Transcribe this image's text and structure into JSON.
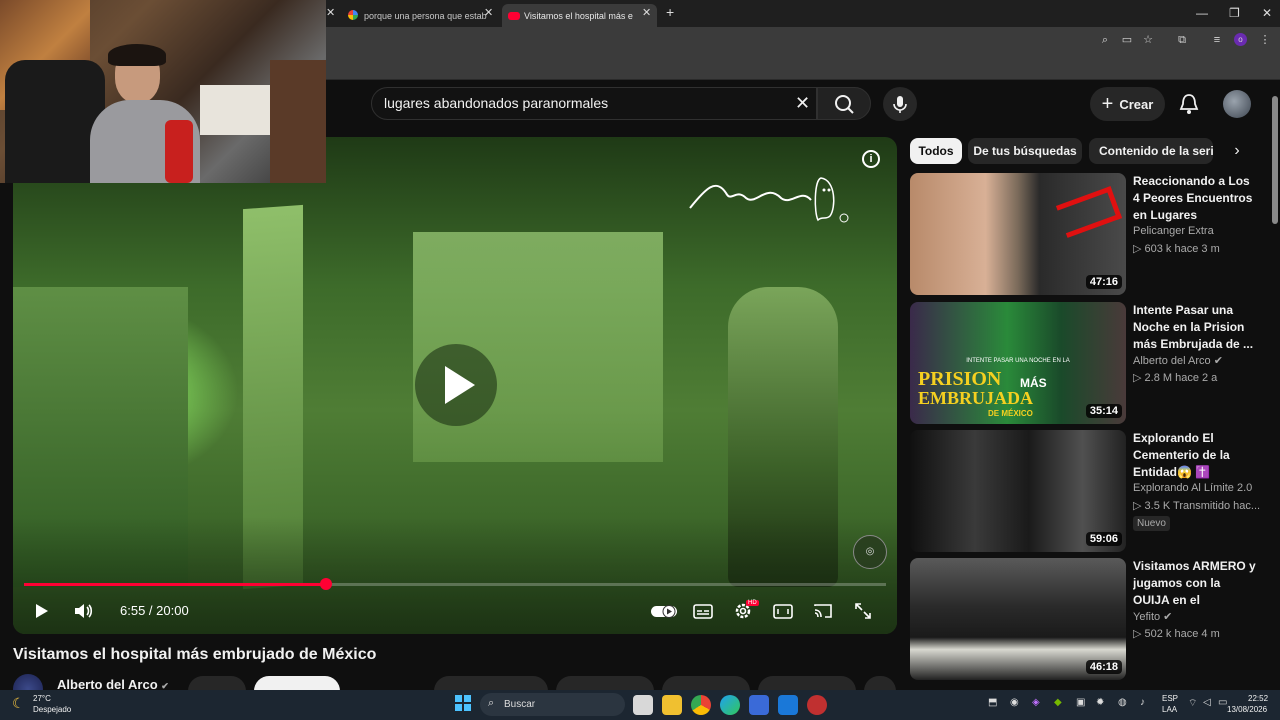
{
  "browser": {
    "tabs": [
      {
        "label": "porque una persona que estab",
        "active": false
      },
      {
        "label": "Visitamos el hospital más e",
        "active": true
      }
    ],
    "new_tab": "+",
    "close": "x"
  },
  "header": {
    "search_query": "lugares abandonados paranormales",
    "create_label": "Crear"
  },
  "player": {
    "time": "6:55 / 20:00",
    "progress": 0.35,
    "info_label": "i",
    "watermark_text": "Alberto del Arco",
    "settings_badge": "HD"
  },
  "video": {
    "title": "Visitamos el hospital más embrujado de México",
    "channel": "Alberto del Arco",
    "verified": "✔"
  },
  "chips": [
    "Todos",
    "De tus búsquedas",
    "Contenido de la serie"
  ],
  "recommendations": [
    {
      "title": "Reaccionando a Los 4 Peores Encuentros en Lugares Abandonado...",
      "channel": "Pelicanger Extra",
      "stats": "▷ 603 k   hace 3 m",
      "duration": "47:16"
    },
    {
      "title": "Intente Pasar una Noche en la Prision más Embrujada de ...",
      "channel": "Alberto del Arco ✔",
      "stats": "▷ 2.8 M   hace 2 a",
      "duration": "35:14",
      "thumb_text": [
        "INTENTE PASAR UNA NOCHE EN LA",
        "PRISION",
        "MÁS",
        "EMBRUJADA",
        "DE MÉXICO"
      ]
    },
    {
      "title": "Explorando El Cementerio de la Entidad😱 ✝️",
      "channel": "Explorando Al Límite 2.0",
      "stats": "▷ 3.5 K   Transmitido hac...",
      "badge": "Nuevo",
      "duration": "59:06"
    },
    {
      "title": "Visitamos ARMERO y jugamos con la OUIJA en el CEMENTERIO | ...",
      "channel": "Yefito ✔",
      "stats": "▷ 502 k   hace 4 m",
      "duration": "46:18"
    }
  ],
  "taskbar": {
    "weather_temp": "27°C",
    "weather_desc": "Despejado",
    "search_label": "Buscar",
    "lang": "ESP",
    "lang_sub": "LAA",
    "time": "22:52",
    "date": "13/08/2026"
  }
}
